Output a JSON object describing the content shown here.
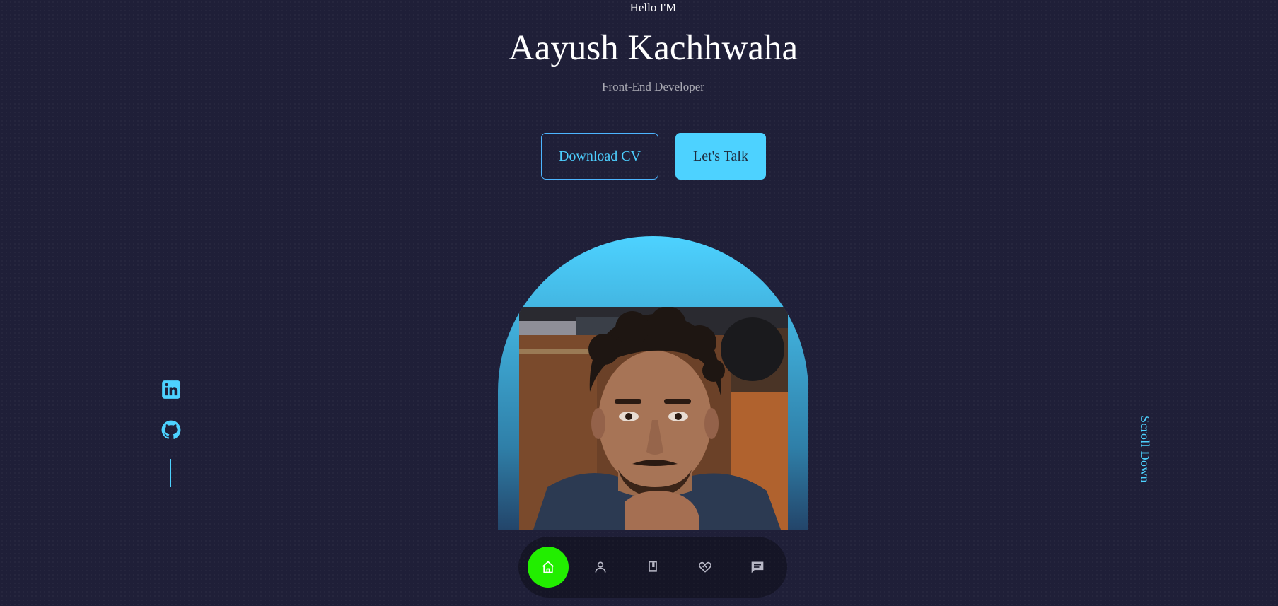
{
  "hero": {
    "greeting": "Hello I'M",
    "name": "Aayush Kachhwaha",
    "role": "Front-End Developer"
  },
  "buttons": {
    "download_cv": "Download CV",
    "lets_talk": "Let's Talk"
  },
  "socials": [
    {
      "icon": "linkedin-icon"
    },
    {
      "icon": "github-icon"
    }
  ],
  "scroll_down": "Scroll Down",
  "nav": {
    "items": [
      {
        "icon": "home-icon",
        "active": true
      },
      {
        "icon": "user-icon",
        "active": false
      },
      {
        "icon": "book-icon",
        "active": false
      },
      {
        "icon": "heart-handshake-icon",
        "active": false
      },
      {
        "icon": "message-icon",
        "active": false
      }
    ]
  },
  "colors": {
    "background": "#1f1f38",
    "accent": "#4dd2ff",
    "nav_active": "#22ee00",
    "text_muted": "rgba(255,255,255,0.62)"
  }
}
